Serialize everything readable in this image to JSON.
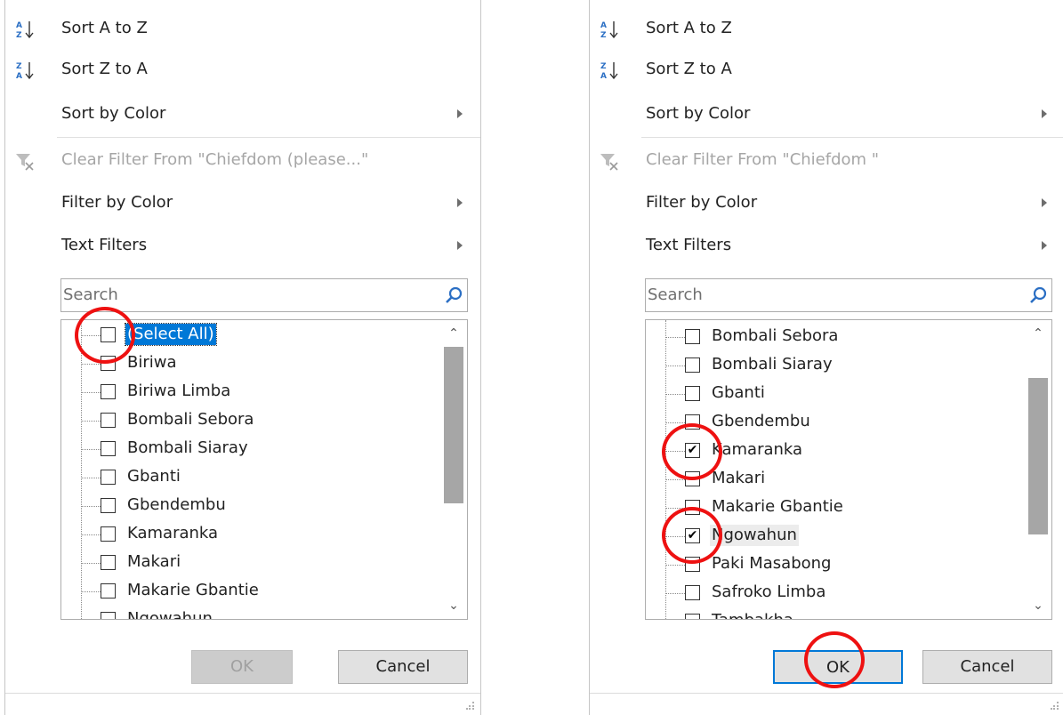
{
  "left": {
    "sort_az": "Sort A to Z",
    "sort_za": "Sort Z to A",
    "sort_by_color": "Sort by Color",
    "clear_filter": "Clear Filter From \"Chiefdom  (please...\"",
    "filter_by_color": "Filter by Color",
    "text_filters": "Text Filters",
    "search_placeholder": "Search",
    "items": [
      "(Select All)",
      "Biriwa",
      "Biriwa Limba",
      "Bombali Sebora",
      "Bombali Siaray",
      "Gbanti",
      "Gbendembu",
      "Kamaranka",
      "Makari",
      "Makarie Gbantie",
      "Ngowahun"
    ],
    "checked": [
      false,
      false,
      false,
      false,
      false,
      false,
      false,
      false,
      false,
      false,
      false
    ],
    "scroll_position": 0.0,
    "ok": "OK",
    "cancel": "Cancel",
    "ok_enabled": false
  },
  "right": {
    "sort_az": "Sort A to Z",
    "sort_za": "Sort Z to A",
    "sort_by_color": "Sort by Color",
    "clear_filter": "Clear Filter From \"Chiefdom  \"",
    "filter_by_color": "Filter by Color",
    "text_filters": "Text Filters",
    "search_placeholder": "Search",
    "items": [
      "Bombali Sebora",
      "Bombali Siaray",
      "Gbanti",
      "Gbendembu",
      "Kamaranka",
      "Makari",
      "Makarie Gbantie",
      "Ngowahun",
      "Paki Masabong",
      "Safroko Limba",
      "Tambakha"
    ],
    "checked": [
      false,
      false,
      false,
      false,
      true,
      false,
      false,
      true,
      false,
      false,
      false
    ],
    "scroll_position": 0.35,
    "ok": "OK",
    "cancel": "Cancel",
    "ok_enabled": true
  },
  "colors": {
    "highlight": "#0078d7",
    "annotation": "#e11111",
    "scroll_thumb": "#a6a6a6"
  }
}
